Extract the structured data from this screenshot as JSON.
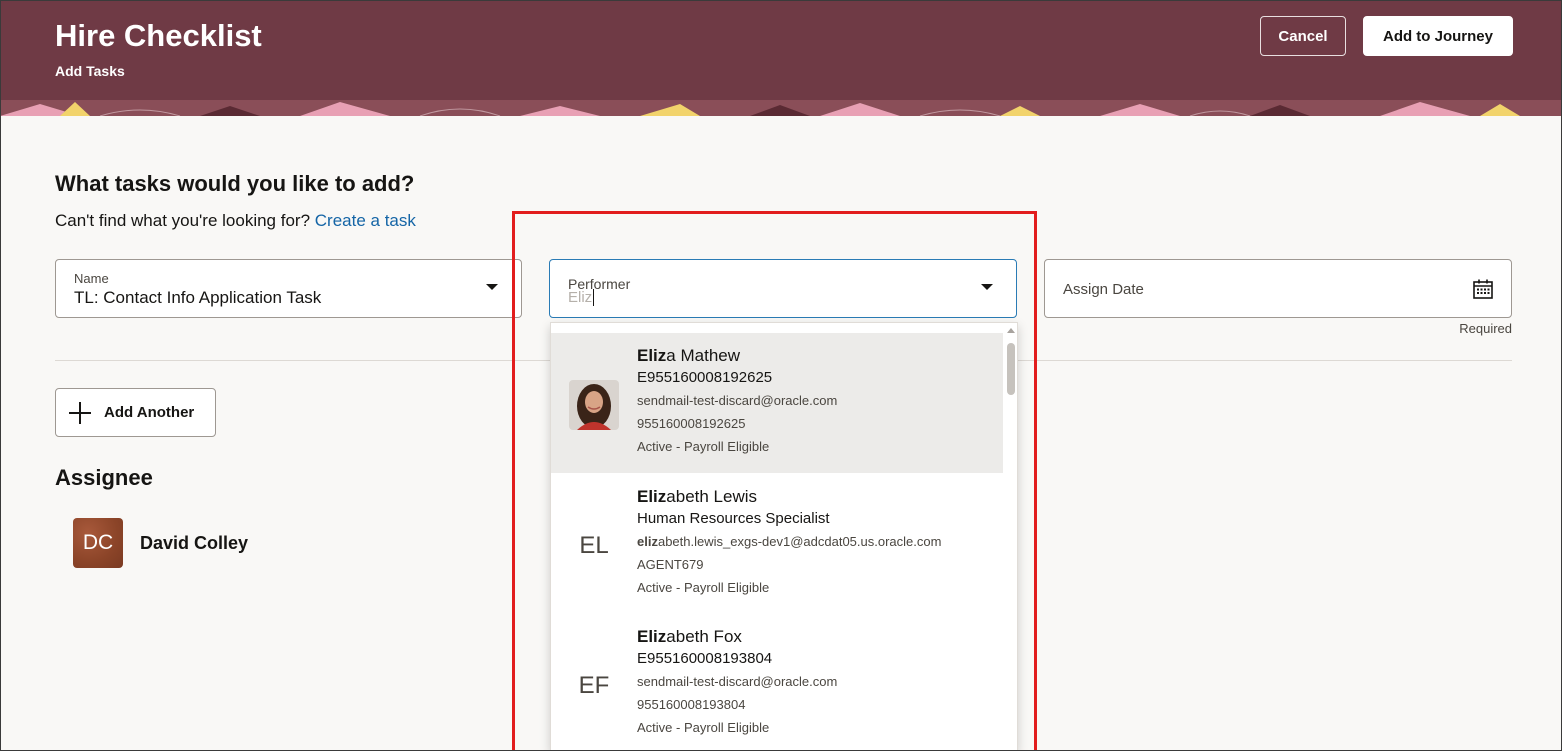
{
  "header": {
    "title": "Hire Checklist",
    "subtitle": "Add Tasks",
    "cancel_label": "Cancel",
    "add_to_journey_label": "Add to Journey",
    "background_color": "#6f3a45"
  },
  "main": {
    "question": "What tasks would you like to add?",
    "helper_text": "Can't find what you're looking for?",
    "create_task_link": "Create a task",
    "name_field": {
      "label": "Name",
      "value": "TL: Contact Info Application Task"
    },
    "performer_field": {
      "label": "Performer",
      "input_value": "Eliz"
    },
    "assign_date_field": {
      "placeholder": "Assign Date",
      "required_text": "Required"
    },
    "add_another_label": "Add Another",
    "assignee_heading": "Assignee",
    "assignee": {
      "initials": "DC",
      "name": "David Colley"
    }
  },
  "dropdown": {
    "options": [
      {
        "match": "Eliz",
        "name_rest": "a Mathew",
        "line2": "E955160008192625",
        "email": "sendmail-test-discard@oracle.com",
        "number": "955160008192625",
        "status": "Active - Payroll Eligible",
        "avatar_type": "photo",
        "highlighted": true
      },
      {
        "match": "Eliz",
        "name_rest": "abeth Lewis",
        "line2": "Human Resources Specialist",
        "email_match": "eliz",
        "email": "abeth.lewis_exgs-dev1@adcdat05.us.oracle.com",
        "number": "AGENT679",
        "status": "Active - Payroll Eligible",
        "initials": "EL"
      },
      {
        "match": "Eliz",
        "name_rest": "abeth Fox",
        "line2": "E955160008193804",
        "email": "sendmail-test-discard@oracle.com",
        "number": "955160008193804",
        "status": "Active - Payroll Eligible",
        "initials": "EF"
      }
    ]
  },
  "colors": {
    "accent_link": "#1565a6",
    "focus_border": "#2a7bb5",
    "highlight_box": "#e21d1d"
  }
}
